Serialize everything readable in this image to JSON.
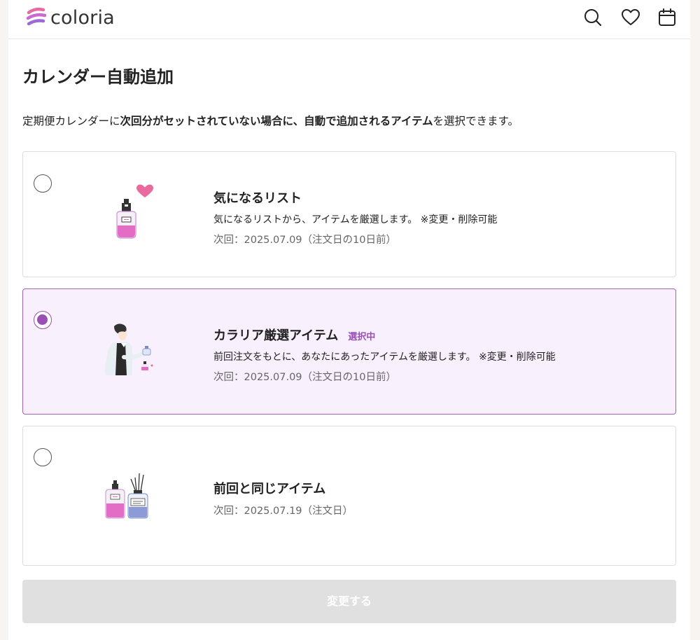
{
  "app": {
    "logo_text": "coloria"
  },
  "header": {
    "icons": [
      "search-icon",
      "heart-icon",
      "calendar-icon"
    ]
  },
  "page": {
    "title": "カレンダー自動追加",
    "description": {
      "part1": "定期便カレンダーに",
      "bold": "次回分がセットされていない場合に、自動で追加されるアイテム",
      "part2": "を選択できます。"
    }
  },
  "options": [
    {
      "title": "気になるリスト",
      "body": "気になるリストから、アイテムを厳選します。 ※変更・削除可能",
      "next": "次回：2025.07.09（注文日の10日前）",
      "selected": false
    },
    {
      "title": "カラリア厳選アイテム",
      "badge": "選択中",
      "body": "前回注文をもとに、あなたにあったアイテムを厳選します。 ※変更・削除可能",
      "next": "次回：2025.07.09（注文日の10日前）",
      "selected": true
    },
    {
      "title": "前回と同じアイテム",
      "next": "次回：2025.07.19（注文日）",
      "selected": false
    }
  ],
  "submit": {
    "label": "変更する",
    "enabled": false
  },
  "colors": {
    "accent": "#9a4fb5",
    "selected_bg": "#f9f0fd",
    "pink": "#e86a9f"
  }
}
